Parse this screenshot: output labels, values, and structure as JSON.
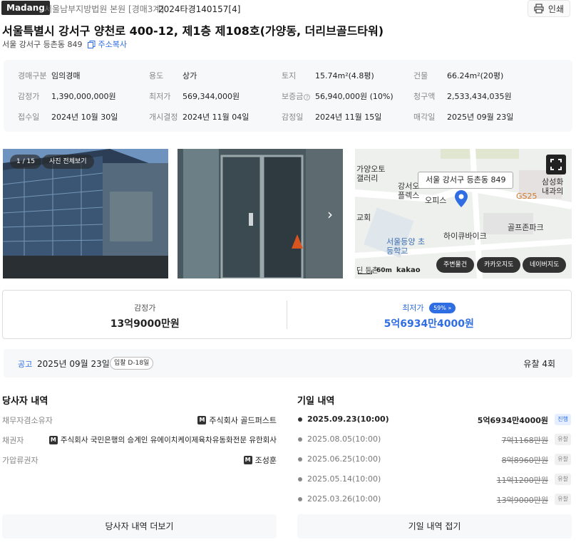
{
  "header": {
    "brand": "Madang",
    "court": "서울남부지방법원 본원 [경매3계]",
    "case_number": "2024타경140157[4]",
    "print_label": "인쇄"
  },
  "property": {
    "title": "서울특별시 강서구 양천로 400-12, 제1층 제108호(가양동, 더리브골드타워)",
    "jibun_address": "서울 강서구 등촌동 849",
    "copy_label": "주소복사"
  },
  "summary": [
    [
      {
        "k": "경매구분",
        "v": "임의경매"
      },
      {
        "k": "용도",
        "v": "상가"
      },
      {
        "k": "토지",
        "v": "15.74m²(4.8평)"
      },
      {
        "k": "건물",
        "v": "66.24m²(20평)"
      }
    ],
    [
      {
        "k": "감정가",
        "v": "1,390,000,000원"
      },
      {
        "k": "최저가",
        "v": "569,344,000원"
      },
      {
        "k": "보증금",
        "v": "56,940,000원 (10%)"
      },
      {
        "k": "청구액",
        "v": "2,533,434,035원"
      }
    ],
    [
      {
        "k": "접수일",
        "v": "2024년 10월 30일"
      },
      {
        "k": "개시결정",
        "v": "2024년 11월 04일"
      },
      {
        "k": "감정일",
        "v": "2024년 11월 15일"
      },
      {
        "k": "매각일",
        "v": "2025년 09월 23일"
      }
    ]
  ],
  "photos": {
    "counter": "1 / 15",
    "view_all": "사진 전체보기"
  },
  "map": {
    "marker_label": "서울 강서구 등촌동 849",
    "scale": "60m",
    "provider": "kakao",
    "labels": [
      "가양오토 갤러리",
      "강서오 플렉스",
      "오피스",
      "교회",
      "하이큐바이크",
      "골프존파크",
      "서울등양 초등학교",
      "GS25",
      "삼성화 내과의",
      "딘 등촌"
    ],
    "buttons": [
      "주변물건",
      "카카오지도",
      "네이버지도"
    ]
  },
  "prices": {
    "appraisal_label": "감정가",
    "appraisal_value": "13억9000만원",
    "minimum_label": "최저가",
    "minimum_percent": "59%",
    "minimum_value": "5억6934만4000원"
  },
  "notice": {
    "tag": "공고",
    "date": "2025년 09월 23일",
    "dday": "입찰 D-18일",
    "fails": "유찰 4회"
  },
  "parties": {
    "title": "당사자 내역",
    "rows": [
      {
        "k": "채무자겸소유자",
        "v": "주식회사 골드퍼스트"
      },
      {
        "k": "채권자",
        "v": "주식회사 국민은행의 승계인 유에이치케이제육차유동화전문 유한회사"
      },
      {
        "k": "가압류권자",
        "v": "조성훈"
      }
    ],
    "more_label": "당사자 내역 더보기"
  },
  "history": {
    "title": "기일 내역",
    "rows": [
      {
        "date": "2025.09.23(10:00)",
        "price": "5억6934만4000원",
        "status": "진행"
      },
      {
        "date": "2025.08.05(10:00)",
        "price": "7억1168만원",
        "status": "유찰"
      },
      {
        "date": "2025.06.25(10:00)",
        "price": "8억8960만원",
        "status": "유찰"
      },
      {
        "date": "2025.05.14(10:00)",
        "price": "11억1200만원",
        "status": "유찰"
      },
      {
        "date": "2025.03.26(10:00)",
        "price": "13억9000만원",
        "status": "유찰"
      }
    ],
    "collapse_label": "기일 내역 접기"
  },
  "colors": {
    "accent": "#2f6ee2",
    "map_marker": "#2f6ee2"
  }
}
